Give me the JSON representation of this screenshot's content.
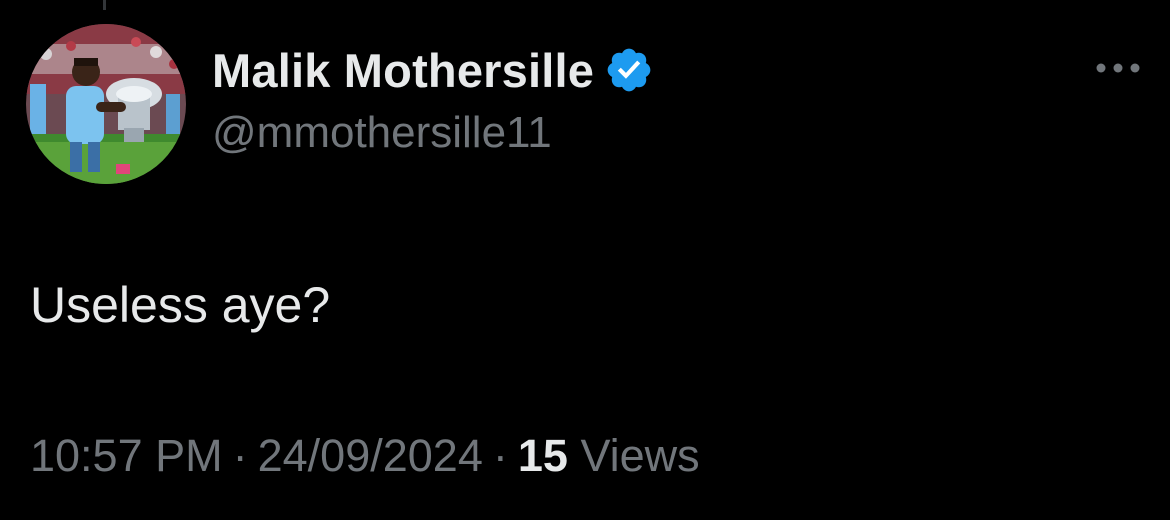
{
  "author": {
    "display_name": "Malik Mothersille",
    "handle": "@mmothersille11",
    "verified": true
  },
  "tweet": {
    "text": "Useless aye?"
  },
  "meta": {
    "time": "10:57 PM",
    "separator": "·",
    "date": "24/09/2024",
    "views_count": "15",
    "views_label": "Views"
  },
  "icons": {
    "verified": "verified-badge-icon",
    "more": "more-options-icon"
  },
  "colors": {
    "background": "#000000",
    "primary_text": "#e7e9ea",
    "secondary_text": "#71767b",
    "verified_blue": "#1d9bf0"
  }
}
